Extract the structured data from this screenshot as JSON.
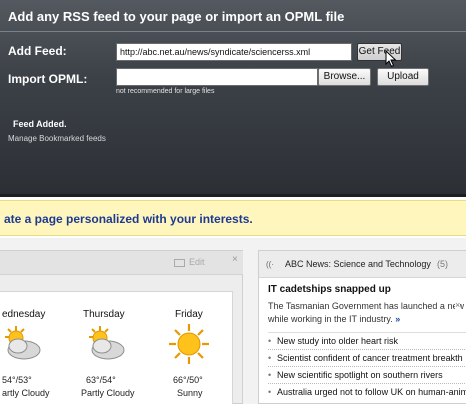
{
  "dialog": {
    "title": "Add any RSS feed to your page or import an OPML file",
    "add_feed_label": "Add Feed:",
    "feed_url_value": "http://abc.net.au/news/syndicate/sciencerss.xml",
    "get_feed_label": "Get Feed",
    "import_opml_label": "Import OPML:",
    "opml_value": "",
    "browse_label": "Browse...",
    "upload_label": "Upload",
    "opml_hint": "not recommended for large files",
    "status_text": "Feed Added.",
    "manage_link": "Manage Bookmarked feeds"
  },
  "banner": {
    "text": "ate a page personalized with your interests."
  },
  "weather_widget": {
    "edit_label": "Edit",
    "close_glyph": "×",
    "days": [
      {
        "day": "ednesday",
        "temp": "54°/53°",
        "condition": "artly Cloudy",
        "icon": "partly-cloudy-icon"
      },
      {
        "day": "Thursday",
        "temp": "63°/54°",
        "condition": "Partly Cloudy",
        "icon": "partly-cloudy-icon"
      },
      {
        "day": "Friday",
        "temp": "66°/50°",
        "condition": "Sunny",
        "icon": "sunny-icon"
      }
    ]
  },
  "news_widget": {
    "title": "ABC News: Science and Technology",
    "count": "(5)",
    "headline": "IT cadetships snapped up",
    "summary": "The Tasmanian Government has launched a new while working in the IT industry.",
    "more": "»",
    "close_glyph": "×",
    "items": [
      "New study into older heart risk",
      "Scientist confident of cancer treatment breakth",
      "New scientific spotlight on southern rivers",
      "Australia urged not to follow UK on human-anim"
    ]
  },
  "colors": {
    "dialog_bg": "#3c4148",
    "banner_bg": "#fff6bd",
    "banner_text": "#1c3a92",
    "link": "#1d48a8"
  }
}
